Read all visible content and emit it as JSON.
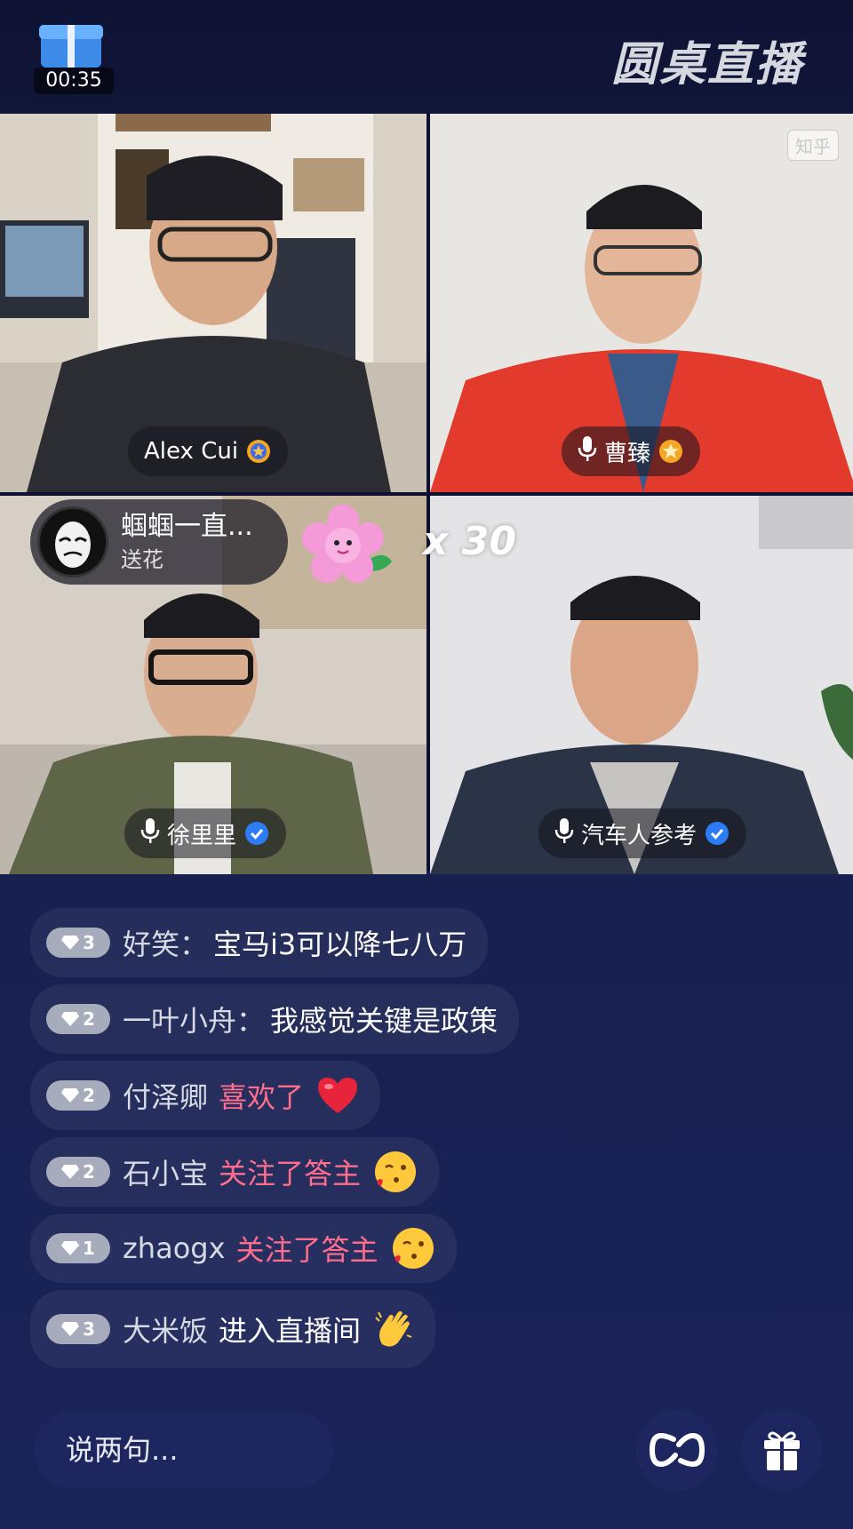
{
  "header": {
    "timer": "00:35",
    "brand": "圆桌直播"
  },
  "participants": [
    {
      "name": "Alex Cui",
      "badge": "gold",
      "mic": false
    },
    {
      "name": "曹臻",
      "badge": "gold",
      "mic": true,
      "watermark": "知乎"
    },
    {
      "name": "徐里里",
      "badge": "blue",
      "mic": true
    },
    {
      "name": "汽车人参考",
      "badge": "blue",
      "mic": true
    }
  ],
  "gift": {
    "user": "蝈蝈一直...",
    "action": "送花",
    "count": "x 30",
    "icon": "flower-icon"
  },
  "chat": [
    {
      "level": "3",
      "user": "好笑：",
      "message": "宝马i3可以降七八万",
      "type": "message"
    },
    {
      "level": "2",
      "user": "一叶小舟：",
      "message": "我感觉关键是政策",
      "type": "message"
    },
    {
      "level": "2",
      "user": "付泽卿",
      "message": "喜欢了",
      "type": "like",
      "icon": "heart-icon"
    },
    {
      "level": "2",
      "user": "石小宝",
      "message": "关注了答主",
      "type": "follow",
      "icon": "kiss-emoji-icon"
    },
    {
      "level": "1",
      "user": "zhaogx",
      "message": "关注了答主",
      "type": "follow",
      "icon": "kiss-emoji-icon"
    },
    {
      "level": "3",
      "user": "大米饭",
      "message": "进入直播间",
      "type": "enter",
      "icon": "clap-emoji-icon"
    }
  ],
  "input": {
    "placeholder": "说两句..."
  },
  "colors": {
    "background": "#141a45",
    "system_pink": "#ff6e8c",
    "badge_gold": "#f5a623",
    "badge_blue": "#2d7cf6"
  }
}
